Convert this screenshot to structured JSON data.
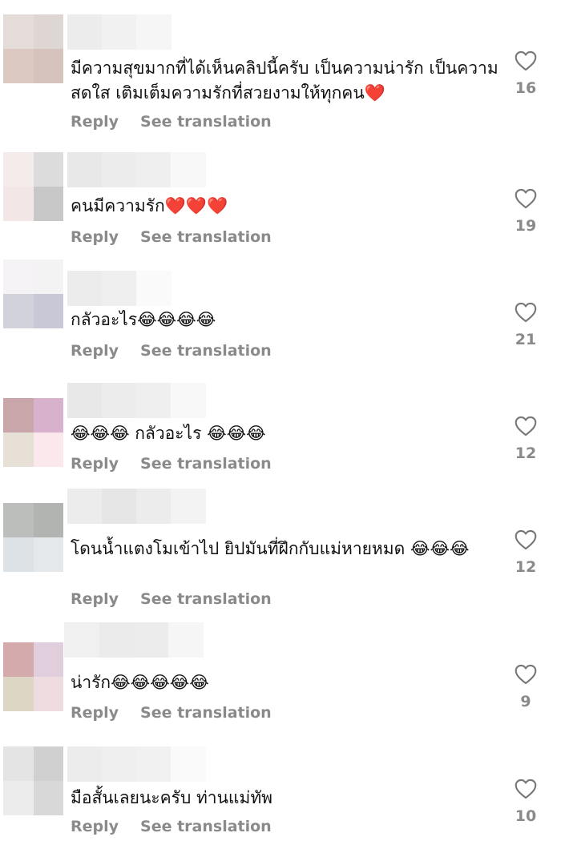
{
  "labels": {
    "reply": "Reply",
    "translate": "See translation"
  },
  "comments": [
    {
      "text": "มีความสุขมากที่ได้เห็นคลิปนี้ครับ เป็นความน่ารัก เป็นความสดใส เติมเต็มความรักที่สวยงามให้ทุกคน❤️",
      "likes": "16"
    },
    {
      "text": "คนมีความรัก❤️❤️❤️",
      "likes": "19"
    },
    {
      "text": "กลัวอะไร😂😂😂😂",
      "likes": "21"
    },
    {
      "text": "😂😂😂 กลัวอะไร 😂😂😂",
      "likes": "12"
    },
    {
      "text": "โดนน้ำแตงโมเข้าไป ยิปมันที่ฝึกกับแม่หายหมด 😂😂😂",
      "likes": "12"
    },
    {
      "text": "น่ารัก😂😂😂😂😂",
      "likes": "9"
    },
    {
      "text": "มือสั้นเลยนะครับ ท่านแม่ทัพ",
      "likes": "10"
    }
  ],
  "avatar_colors": [
    [
      "#e3dcd8",
      "#ddd6d2",
      "#dccac2",
      "#d6c3bd"
    ],
    [
      "#f3ecea",
      "#dcdcdc",
      "#f3e6e6",
      "#c8c8c8"
    ],
    [
      "#f5f3f5",
      "#f3f3f3",
      "#d2d2da",
      "#c8c8d6"
    ],
    [
      "#c8a6aa",
      "#d8b2cc",
      "#e6e0d6",
      "#fbe8ec"
    ],
    [
      "#bcbebc",
      "#b2b4b2",
      "#dde2e6",
      "#e4e8ea"
    ],
    [
      "#d4aaac",
      "#e0cedc",
      "#ddd6c4",
      "#eedce0"
    ],
    [
      "#e4e4e4",
      "#d0d0d0",
      "#ececec",
      "#d8d8d8"
    ]
  ]
}
